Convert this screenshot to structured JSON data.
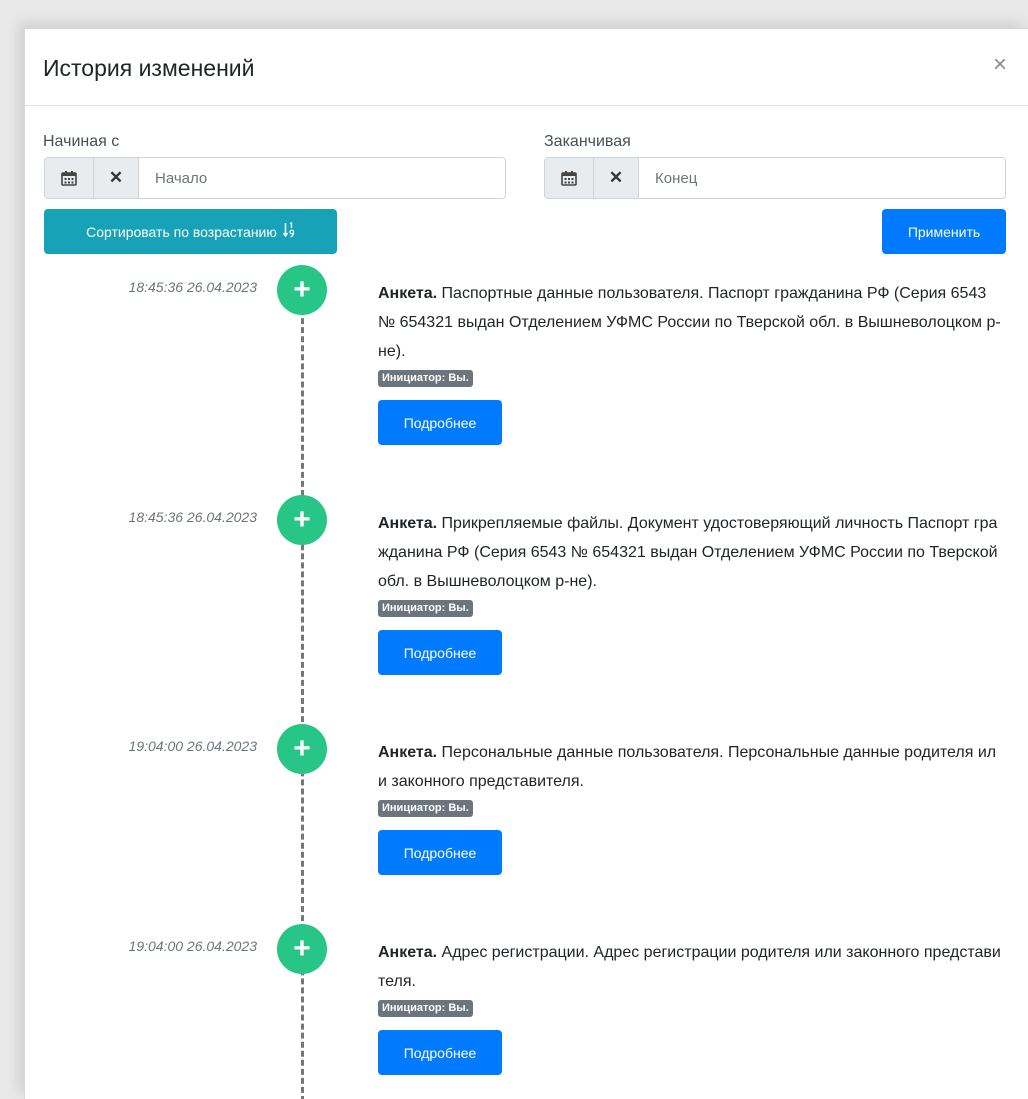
{
  "modal": {
    "title": "История изменений",
    "close_glyph": "×"
  },
  "filters": {
    "start": {
      "label": "Начиная с",
      "placeholder": "Начало",
      "value": ""
    },
    "end": {
      "label": "Заканчивая",
      "placeholder": "Конец",
      "value": ""
    },
    "clear_glyph": "✕"
  },
  "buttons": {
    "sort_label": "Сортировать по возрастанию",
    "apply_label": "Применить"
  },
  "icons": {
    "calendar": "calendar-icon",
    "clear": "times-icon",
    "sort": "sort-numeric-icon",
    "add": "plus-icon"
  },
  "colors": {
    "primary": "#007bff",
    "info": "#17a2b8",
    "success_dot": "#28c686",
    "badge": "#6c757d"
  },
  "timeline": [
    {
      "time": "18:45:36 26.04.2023",
      "heading": "Анкета.",
      "text": " Паспортные данные пользователя. Паспорт гражданина РФ (Серия 6543 № 654321 выдан Отделением УФМС России по Тверской обл. в Вышневолоцком р-не).",
      "badge": "Инициатор: Вы.",
      "button": "Подробнее"
    },
    {
      "time": "18:45:36 26.04.2023",
      "heading": "Анкета.",
      "text": " Прикрепляемые файлы. Документ удостоверяющий личность Паспорт гражданина РФ (Серия 6543 № 654321 выдан Отделением УФМС России по Тверской обл. в Вышневолоцком р-не).",
      "badge": "Инициатор: Вы.",
      "button": "Подробнее"
    },
    {
      "time": "19:04:00 26.04.2023",
      "heading": "Анкета.",
      "text": " Персональные данные пользователя. Персональные данные родителя или законного представителя.",
      "badge": "Инициатор: Вы.",
      "button": "Подробнее"
    },
    {
      "time": "19:04:00 26.04.2023",
      "heading": "Анкета.",
      "text": " Адрес регистрации. Адрес регистрации родителя или законного представителя.",
      "badge": "Инициатор: Вы.",
      "button": "Подробнее"
    }
  ]
}
